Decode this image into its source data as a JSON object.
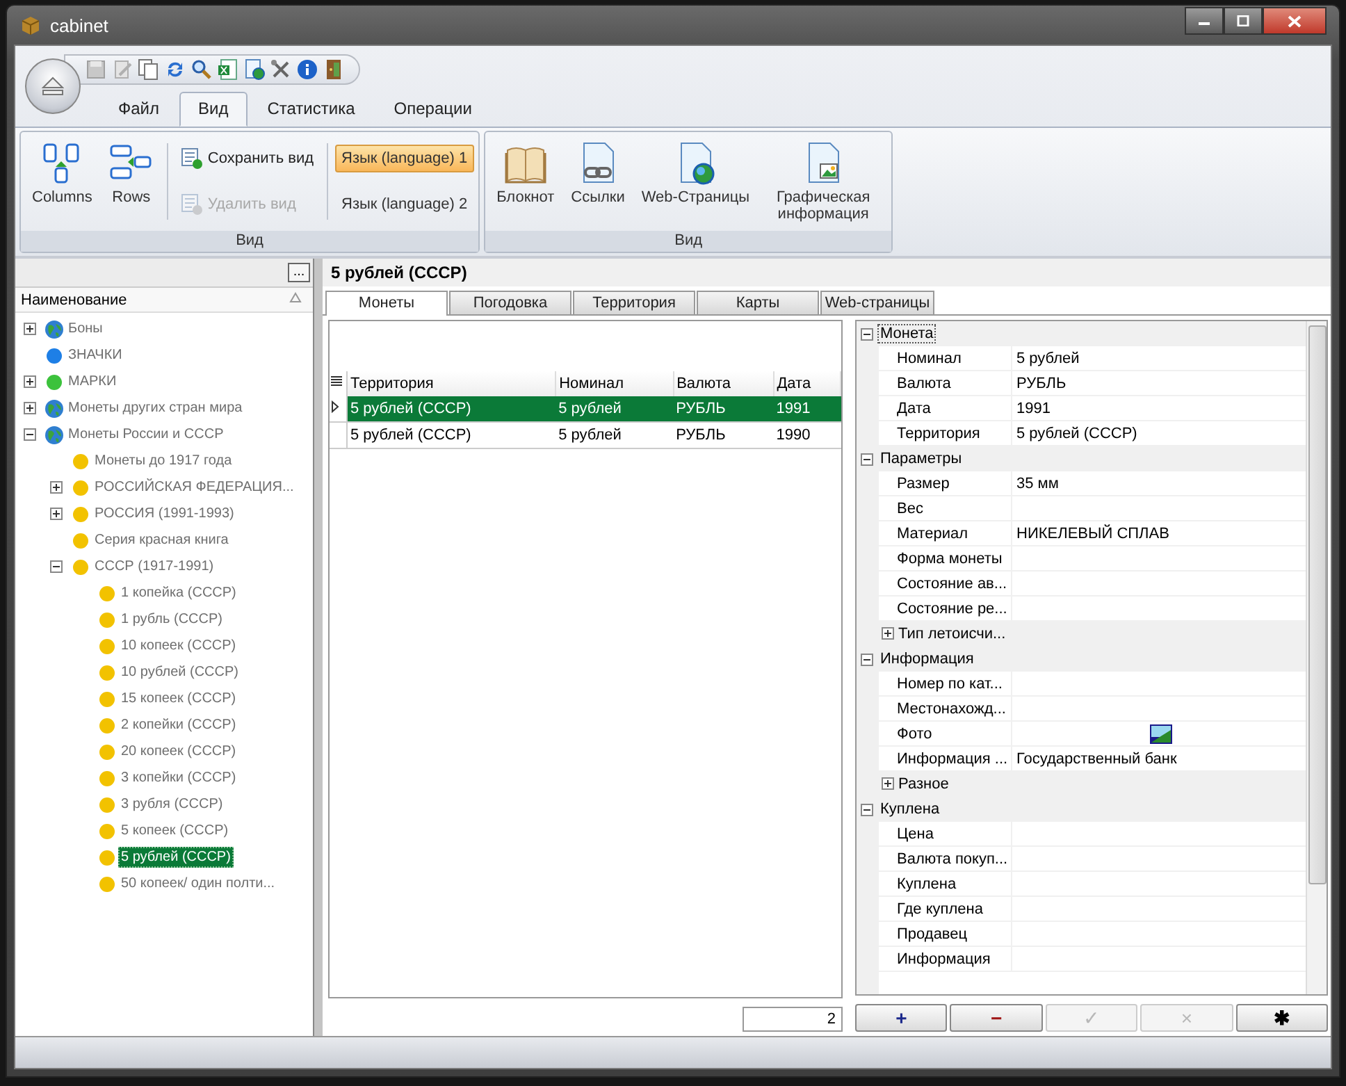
{
  "window": {
    "title": "cabinet"
  },
  "ribbon": {
    "tabs": [
      {
        "label": "Файл",
        "selected": false
      },
      {
        "label": "Вид",
        "selected": true
      },
      {
        "label": "Статистика",
        "selected": false
      },
      {
        "label": "Операции",
        "selected": false
      }
    ],
    "groups": [
      {
        "label": "Вид",
        "large_buttons": [
          "Columns",
          "Rows"
        ],
        "small_buttons": [
          {
            "label": "Сохранить вид",
            "disabled": false
          },
          {
            "label": "Удалить вид",
            "disabled": true
          }
        ],
        "language_buttons": [
          {
            "label": "Язык (language) 1",
            "selected": true
          },
          {
            "label": "Язык (language) 2",
            "selected": false
          }
        ]
      },
      {
        "label": "Вид",
        "large_buttons": [
          "Блокнот",
          "Ссылки",
          "Web-Страницы",
          "Графическая информация"
        ]
      }
    ]
  },
  "tree": {
    "menu_button": "...",
    "header": "Наименование",
    "items": [
      {
        "label": "Боны",
        "kind": "globe",
        "expanded": false,
        "selected": false
      },
      {
        "label": "ЗНАЧКИ",
        "kind": "dot",
        "color": "#1e7fe6",
        "selected": false
      },
      {
        "label": "МАРКИ",
        "kind": "dot",
        "color": "#3cc23c",
        "expanded": false,
        "selected": false
      },
      {
        "label": "Монеты других стран мира",
        "kind": "globe",
        "expanded": false,
        "selected": false
      },
      {
        "label": "Монеты России и СССР",
        "kind": "globe",
        "expanded": true,
        "selected": false,
        "children": [
          {
            "label": "Монеты до 1917 года",
            "kind": "dot",
            "color": "#f2c200",
            "selected": false
          },
          {
            "label": "РОССИЙСКАЯ ФЕДЕРАЦИЯ...",
            "kind": "dot",
            "color": "#f2c200",
            "expanded": false,
            "selected": false
          },
          {
            "label": "РОССИЯ (1991-1993)",
            "kind": "dot",
            "color": "#f2c200",
            "expanded": false,
            "selected": false
          },
          {
            "label": "Серия красная книга",
            "kind": "dot",
            "color": "#f2c200",
            "selected": false
          },
          {
            "label": "СССР (1917-1991)",
            "kind": "dot",
            "color": "#f2c200",
            "expanded": true,
            "selected": false,
            "children": [
              {
                "label": "1 копейка (СССР)",
                "kind": "dot",
                "color": "#f2c200",
                "selected": false
              },
              {
                "label": "1 рубль (СССР)",
                "kind": "dot",
                "color": "#f2c200",
                "selected": false
              },
              {
                "label": "10 копеек (СССР)",
                "kind": "dot",
                "color": "#f2c200",
                "selected": false
              },
              {
                "label": "10 рублей (СССР)",
                "kind": "dot",
                "color": "#f2c200",
                "selected": false
              },
              {
                "label": "15 копеек (СССР)",
                "kind": "dot",
                "color": "#f2c200",
                "selected": false
              },
              {
                "label": "2 копейки (СССР)",
                "kind": "dot",
                "color": "#f2c200",
                "selected": false
              },
              {
                "label": "20 копеек (СССР)",
                "kind": "dot",
                "color": "#f2c200",
                "selected": false
              },
              {
                "label": "3 копейки (СССР)",
                "kind": "dot",
                "color": "#f2c200",
                "selected": false
              },
              {
                "label": "3 рубля (СССР)",
                "kind": "dot",
                "color": "#f2c200",
                "selected": false
              },
              {
                "label": "5 копеек (СССР)",
                "kind": "dot",
                "color": "#f2c200",
                "selected": false
              },
              {
                "label": "5 рублей (СССР)",
                "kind": "dot",
                "color": "#f2c200",
                "selected": true
              },
              {
                "label": "50 копеек/ один полти...",
                "kind": "dot",
                "color": "#f2c200",
                "selected": false
              }
            ]
          }
        ]
      }
    ]
  },
  "detail": {
    "title": "5 рублей (СССР)",
    "tabs": [
      {
        "label": "Монеты",
        "selected": true
      },
      {
        "label": "Погодовка",
        "selected": false
      },
      {
        "label": "Территория",
        "selected": false
      },
      {
        "label": "Карты",
        "selected": false
      },
      {
        "label": "Web-страницы",
        "selected": false
      }
    ],
    "table": {
      "columns": [
        "Территория",
        "Номинал",
        "Валюта",
        "Дата"
      ],
      "rows": [
        {
          "cells": [
            "5 рублей (СССР)",
            "5 рублей",
            "РУБЛЬ",
            "1991"
          ],
          "selected": true
        },
        {
          "cells": [
            "5 рублей (СССР)",
            "5 рублей",
            "РУБЛЬ",
            "1990"
          ],
          "selected": false
        }
      ]
    },
    "record_count": "2",
    "properties": [
      {
        "label": "Монета",
        "expanded": true,
        "selected": true,
        "rows": [
          {
            "kind": "text",
            "name": "Номинал",
            "value": "5 рублей"
          },
          {
            "kind": "text",
            "name": "Валюта",
            "value": "РУБЛЬ"
          },
          {
            "kind": "text",
            "name": "Дата",
            "value": "1991"
          },
          {
            "kind": "text",
            "name": "Территория",
            "value": "5 рублей (СССР)"
          }
        ]
      },
      {
        "label": "Параметры",
        "expanded": true,
        "selected": false,
        "rows": [
          {
            "kind": "text",
            "name": "Размер",
            "value": "35 мм"
          },
          {
            "kind": "text",
            "name": "Вес"
          },
          {
            "kind": "text",
            "name": "Материал",
            "value": "НИКЕЛЕВЫЙ СПЛАВ"
          },
          {
            "kind": "text",
            "name": "Форма монеты"
          },
          {
            "kind": "text",
            "name": "Состояние ав..."
          },
          {
            "kind": "text",
            "name": "Состояние ре..."
          },
          {
            "kind": "group",
            "name": "Тип летоисчи...",
            "expanded": false
          }
        ]
      },
      {
        "label": "Информация",
        "expanded": true,
        "selected": false,
        "rows": [
          {
            "kind": "text",
            "name": "Номер по кат..."
          },
          {
            "kind": "text",
            "name": "Местонахожд..."
          },
          {
            "name": "Фото"
          },
          {
            "kind": "text",
            "name": "Информация ...",
            "value": "Государственный банк"
          },
          {
            "kind": "group",
            "name": "Разное",
            "expanded": false
          }
        ]
      },
      {
        "label": "Куплена",
        "expanded": true,
        "selected": false,
        "rows": [
          {
            "kind": "text",
            "name": "Цена"
          },
          {
            "kind": "text",
            "name": "Валюта покуп..."
          },
          {
            "kind": "text",
            "name": "Куплена"
          },
          {
            "kind": "text",
            "name": "Где куплена"
          },
          {
            "kind": "text",
            "name": "Продавец"
          },
          {
            "kind": "text",
            "name": "Информация"
          }
        ]
      }
    ],
    "buttons": [
      {
        "label": "+",
        "color": "#1c2a8c",
        "disabled": false
      },
      {
        "label": "−",
        "color": "#a01818",
        "disabled": false
      },
      {
        "label": "✓",
        "color": "#b8b8b8",
        "disabled": true
      },
      {
        "label": "×",
        "color": "#b8b8b8",
        "disabled": true
      },
      {
        "label": "✱",
        "color": "#000000",
        "disabled": false
      }
    ]
  }
}
